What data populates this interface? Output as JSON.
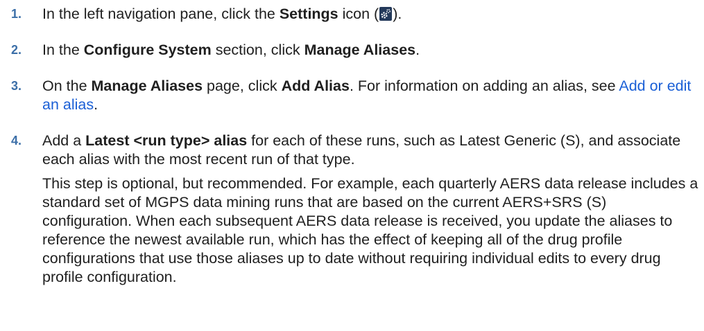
{
  "steps": [
    {
      "number": "1.",
      "p1_a": "In the left navigation pane, click the ",
      "p1_b": "Settings",
      "p1_c": " icon (",
      "icon": "settings-gear-icon",
      "p1_d": ")."
    },
    {
      "number": "2.",
      "p1_a": "In the ",
      "p1_b": "Configure System",
      "p1_c": " section, click ",
      "p1_d": "Manage Aliases",
      "p1_e": "."
    },
    {
      "number": "3.",
      "p1_a": "On the ",
      "p1_b": "Manage Aliases",
      "p1_c": " page, click ",
      "p1_d": "Add Alias",
      "p1_e": ". For information on adding an alias, see ",
      "link": "Add or edit an alias",
      "p1_f": "."
    },
    {
      "number": "4.",
      "p1_a": "Add a ",
      "p1_b": "Latest <run type> alias",
      "p1_c": " for each of these runs, such as Latest Generic (S), and associate each alias with the most recent run of that type.",
      "p2": "This step is optional, but recommended. For example, each quarterly AERS data release includes a standard set of MGPS data mining runs that are based on the current AERS+SRS (S) configuration. When each subsequent AERS data release is received, you update the aliases to reference the newest available run, which has the effect of keeping all of the drug profile configurations that use those aliases up to date without requiring individual edits to every drug profile configuration."
    }
  ]
}
